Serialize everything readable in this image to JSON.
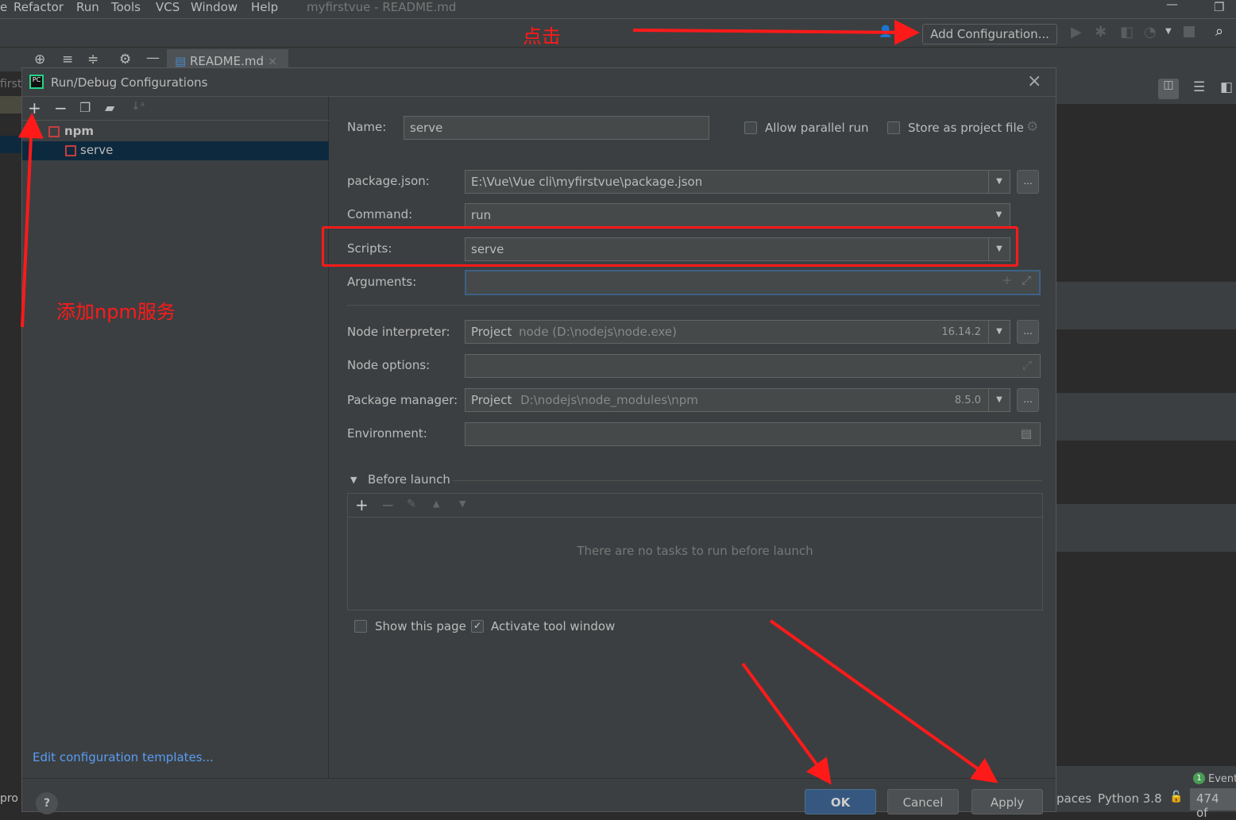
{
  "menu": {
    "items": [
      "e",
      "Refactor",
      "Run",
      "Tools",
      "VCS",
      "Window",
      "Help"
    ],
    "title": "myfirstvue - README.md"
  },
  "toolbar": {
    "add_config": "Add Configuration..."
  },
  "tab": {
    "label": "README.md"
  },
  "sidebar_fragments": {
    "first": "first",
    "pro": "pro"
  },
  "dialog": {
    "title": "Run/Debug Configurations",
    "tree": {
      "group": "npm",
      "item": "serve"
    },
    "edit_templates": "Edit configuration templates...",
    "name_label": "Name:",
    "name_value": "serve",
    "allow_parallel": "Allow parallel run",
    "store_project": "Store as project file",
    "package_json_label": "package.json:",
    "package_json_value": "E:\\Vue\\Vue cli\\myfirstvue\\package.json",
    "command_label": "Command:",
    "command_value": "run",
    "scripts_label": "Scripts:",
    "scripts_value": "serve",
    "arguments_label": "Arguments:",
    "node_interp_label": "Node interpreter:",
    "node_interp_prefix": "Project",
    "node_interp_value": "node (D:\\nodejs\\node.exe)",
    "node_version": "16.14.2",
    "node_options_label": "Node options:",
    "pkg_mgr_label": "Package manager:",
    "pkg_mgr_prefix": "Project",
    "pkg_mgr_value": "D:\\nodejs\\node_modules\\npm",
    "pkg_mgr_version": "8.5.0",
    "env_label": "Environment:",
    "before_launch": "Before launch",
    "no_tasks": "There are no tasks to run before launch",
    "show_page": "Show this page",
    "activate_tool": "Activate tool window",
    "activate_checked": true,
    "show_checked": false,
    "ok": "OK",
    "cancel": "Cancel",
    "apply": "Apply",
    "ellipsis": "..."
  },
  "status": {
    "spaces": "paces",
    "python": "Python 3.8",
    "lines": "474 of",
    "event_count": "1",
    "event": "Event"
  },
  "annotations": {
    "click": "点击",
    "add_npm": "添加npm服务"
  },
  "colors": {
    "annotation": "#ff1a1a",
    "ok_button": "#365880",
    "selection": "#0d293e",
    "link": "#589df6"
  }
}
